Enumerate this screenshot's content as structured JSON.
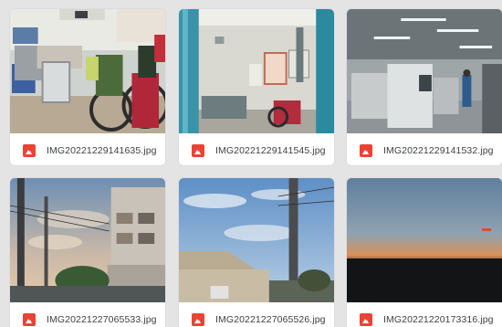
{
  "files": [
    {
      "name": "IMG20221229141635.jpg",
      "icon": "image-file-icon",
      "icon_color": "#ea4335"
    },
    {
      "name": "IMG20221229141545.jpg",
      "icon": "image-file-icon",
      "icon_color": "#ea4335"
    },
    {
      "name": "IMG20221229141532.jpg",
      "icon": "image-file-icon",
      "icon_color": "#ea4335"
    },
    {
      "name": "IMG20221227065533.jpg",
      "icon": "image-file-icon",
      "icon_color": "#ea4335"
    },
    {
      "name": "IMG20221227065526.jpg",
      "icon": "image-file-icon",
      "icon_color": "#ea4335"
    },
    {
      "name": "IMG20221220173316.jpg",
      "icon": "image-file-icon",
      "icon_color": "#ea4335"
    }
  ]
}
